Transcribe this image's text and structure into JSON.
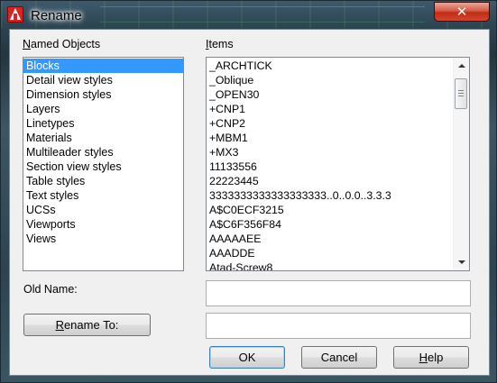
{
  "window": {
    "title": "Rename",
    "close_glyph": "✕"
  },
  "named_objects": {
    "label_underline": "N",
    "label_rest": "amed Objects",
    "items": [
      "Blocks",
      "Detail view styles",
      "Dimension styles",
      "Layers",
      "Linetypes",
      "Materials",
      "Multileader styles",
      "Section view styles",
      "Table styles",
      "Text styles",
      "UCSs",
      "Viewports",
      "Views"
    ],
    "selected": "Blocks"
  },
  "items_panel": {
    "label_underline": "I",
    "label_rest": "tems",
    "items": [
      "_ARCHTICK",
      "_Oblique",
      "_OPEN30",
      "+CNP1",
      "+CNP2",
      "+MBM1",
      "+MX3",
      "11133556",
      "22223445",
      "3333333333333333333..0..0.0..3.3.3",
      "A$C0ECF3215",
      "A$C6F356F84",
      "AAAAAEE",
      "AAADDE",
      "Atad-Screw8"
    ]
  },
  "old_name": {
    "label": "Old Name:",
    "value": ""
  },
  "rename_to": {
    "label_underline": "R",
    "label_rest": "ename To:",
    "value": ""
  },
  "buttons": {
    "ok": "OK",
    "cancel": "Cancel",
    "help_underline": "H",
    "help_rest": "elp"
  },
  "icons": {
    "app": "autocad-app-icon",
    "close": "close-icon",
    "scroll_up": "scroll-up-arrow-icon",
    "scroll_down": "scroll-down-arrow-icon"
  },
  "colors": {
    "selection": "#3399ff",
    "close_button": "#c8331b",
    "dialog_bg": "#f0f0f0"
  }
}
